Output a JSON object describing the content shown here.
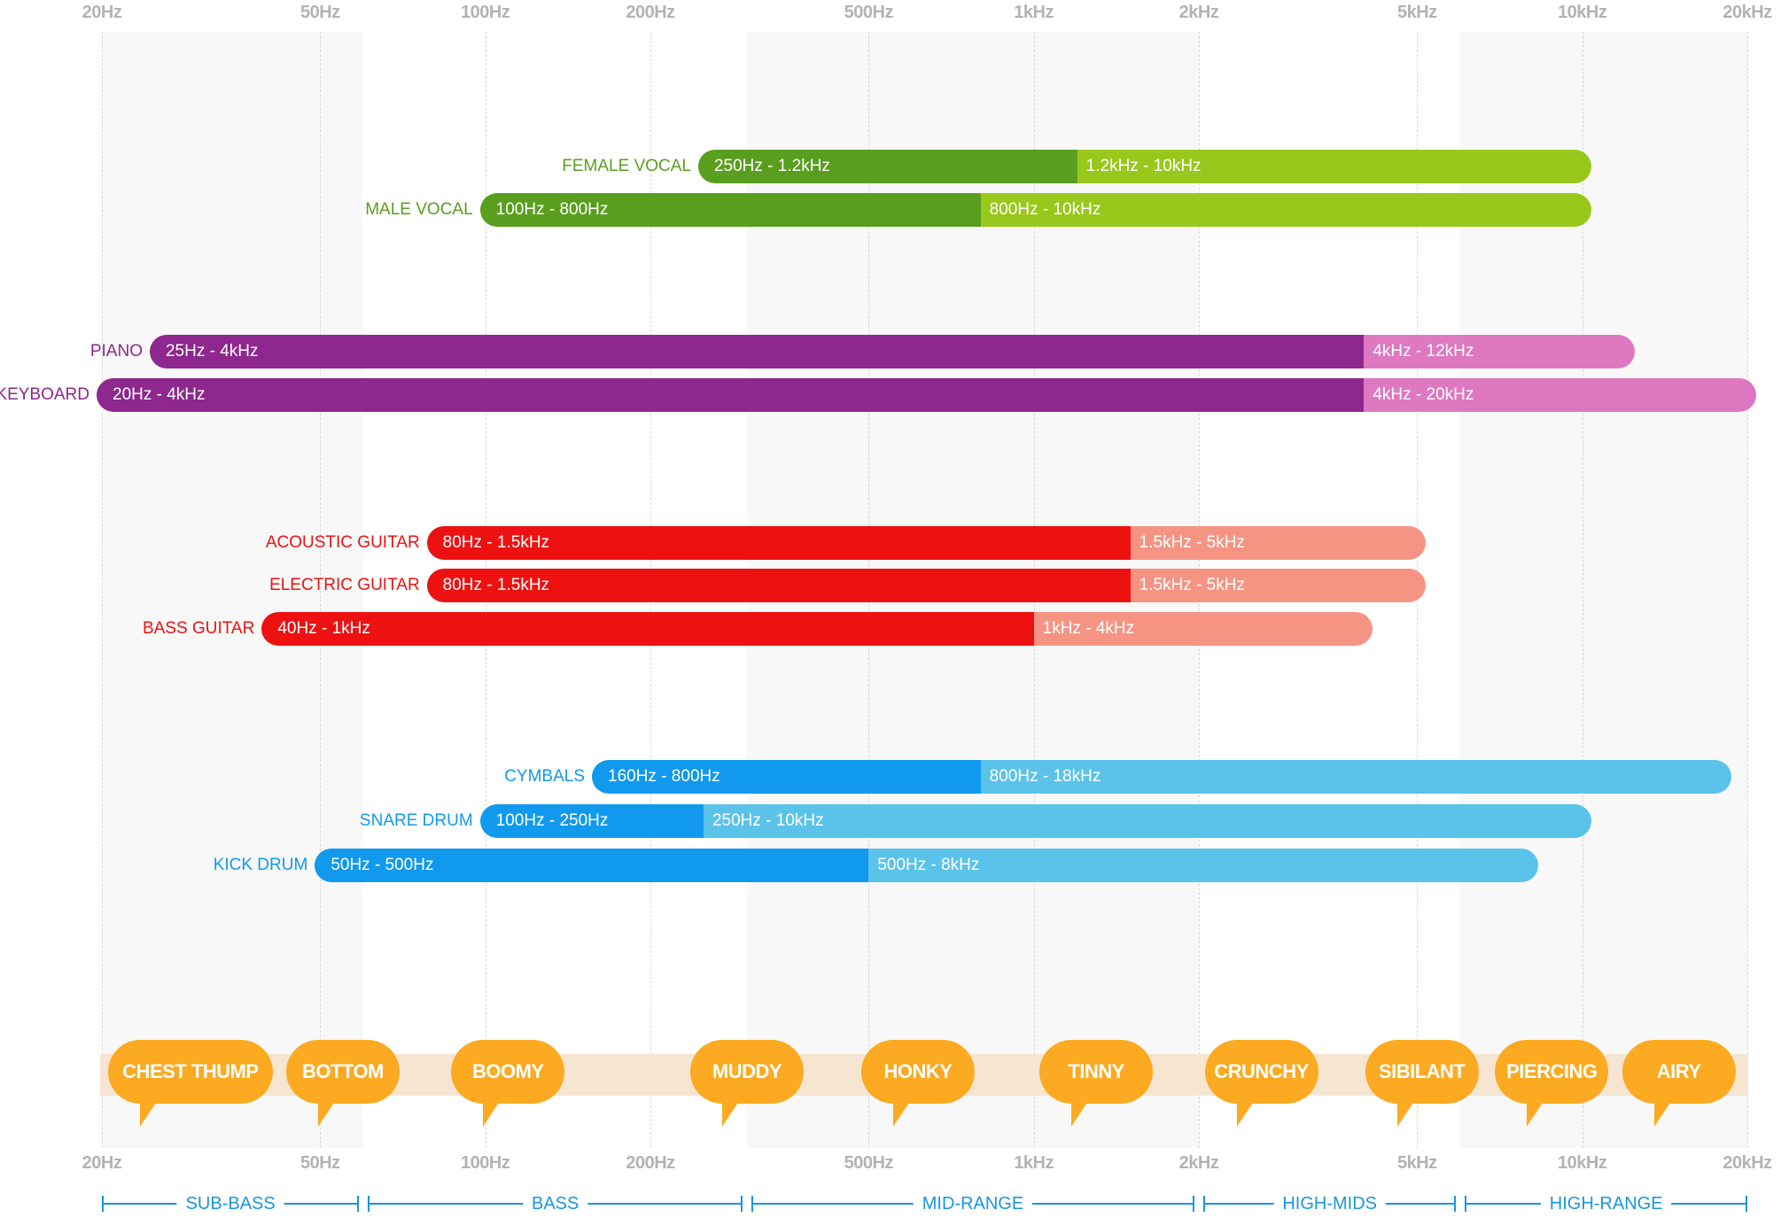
{
  "chart_data": {
    "type": "bar",
    "orientation": "horizontal-range",
    "x_scale": "log",
    "xlim": [
      20,
      20000
    ],
    "grid": true,
    "x_ticks": [
      {
        "label": "20Hz",
        "value": 20
      },
      {
        "label": "50Hz",
        "value": 50
      },
      {
        "label": "100Hz",
        "value": 100
      },
      {
        "label": "200Hz",
        "value": 200
      },
      {
        "label": "500Hz",
        "value": 500
      },
      {
        "label": "1kHz",
        "value": 1000
      },
      {
        "label": "2kHz",
        "value": 2000
      },
      {
        "label": "5kHz",
        "value": 5000
      },
      {
        "label": "10kHz",
        "value": 10000
      },
      {
        "label": "20kHz",
        "value": 20000
      }
    ],
    "colors": {
      "vocal": [
        "#5a9e1f",
        "#99c81c"
      ],
      "keys": [
        "#8e278e",
        "#dd78c1"
      ],
      "guitar": [
        "#ee1111",
        "#f69484"
      ],
      "drums": [
        "#1199ee",
        "#5bc3ea"
      ],
      "tag": "#fbaa22",
      "tag_band": "#f6e5d0",
      "range": "#1a95e0"
    },
    "instruments": [
      {
        "name": "FEMALE VOCAL",
        "group": "vocal",
        "row": 0,
        "segments": [
          {
            "label": "250Hz - 1.2kHz",
            "from": 250,
            "to": 1200
          },
          {
            "label": "1.2kHz - 10kHz",
            "from": 1200,
            "to": 10000
          }
        ]
      },
      {
        "name": "MALE VOCAL",
        "group": "vocal",
        "row": 1,
        "segments": [
          {
            "label": "100Hz - 800Hz",
            "from": 100,
            "to": 800
          },
          {
            "label": "800Hz - 10kHz",
            "from": 800,
            "to": 10000
          }
        ]
      },
      {
        "name": "PIANO",
        "group": "keys",
        "row": 2,
        "segments": [
          {
            "label": "25Hz - 4kHz",
            "from": 25,
            "to": 4000
          },
          {
            "label": "4kHz - 12kHz",
            "from": 4000,
            "to": 12000
          }
        ]
      },
      {
        "name": "KEYBOARD",
        "group": "keys",
        "row": 3,
        "segments": [
          {
            "label": "20Hz - 4kHz",
            "from": 20,
            "to": 4000
          },
          {
            "label": "4kHz - 20kHz",
            "from": 4000,
            "to": 20000
          }
        ]
      },
      {
        "name": "ACOUSTIC GUITAR",
        "group": "guitar",
        "row": 4,
        "segments": [
          {
            "label": "80Hz - 1.5kHz",
            "from": 80,
            "to": 1500
          },
          {
            "label": "1.5kHz - 5kHz",
            "from": 1500,
            "to": 5000
          }
        ]
      },
      {
        "name": "ELECTRIC GUITAR",
        "group": "guitar",
        "row": 5,
        "segments": [
          {
            "label": "80Hz - 1.5kHz",
            "from": 80,
            "to": 1500
          },
          {
            "label": "1.5kHz - 5kHz",
            "from": 1500,
            "to": 5000
          }
        ]
      },
      {
        "name": "BASS GUITAR",
        "group": "guitar",
        "row": 6,
        "segments": [
          {
            "label": "40Hz - 1kHz",
            "from": 40,
            "to": 1000
          },
          {
            "label": "1kHz - 4kHz",
            "from": 1000,
            "to": 4000
          }
        ]
      },
      {
        "name": "CYMBALS",
        "group": "drums",
        "row": 7,
        "segments": [
          {
            "label": "160Hz - 800Hz",
            "from": 160,
            "to": 800
          },
          {
            "label": "800Hz - 18kHz",
            "from": 800,
            "to": 18000
          }
        ]
      },
      {
        "name": "SNARE DRUM",
        "group": "drums",
        "row": 8,
        "segments": [
          {
            "label": "100Hz - 250Hz",
            "from": 100,
            "to": 250
          },
          {
            "label": "250Hz - 10kHz",
            "from": 250,
            "to": 10000
          }
        ]
      },
      {
        "name": "KICK DRUM",
        "group": "drums",
        "row": 9,
        "segments": [
          {
            "label": "50Hz - 500Hz",
            "from": 50,
            "to": 500
          },
          {
            "label": "500Hz - 8kHz",
            "from": 500,
            "to": 8000
          }
        ]
      }
    ],
    "tags": [
      {
        "label": "CHEST THUMP",
        "freq": 29
      },
      {
        "label": "BOTTOM",
        "freq": 55
      },
      {
        "label": "BOOMY",
        "freq": 110
      },
      {
        "label": "MUDDY",
        "freq": 300
      },
      {
        "label": "HONKY",
        "freq": 615
      },
      {
        "label": "TINNY",
        "freq": 1300
      },
      {
        "label": "CRUNCHY",
        "freq": 2600
      },
      {
        "label": "SIBILANT",
        "freq": 5100
      },
      {
        "label": "PIERCING",
        "freq": 8800
      },
      {
        "label": "AIRY",
        "freq": 15000
      }
    ],
    "ranges": [
      {
        "label": "SUB-BASS",
        "from": 20,
        "to": 60
      },
      {
        "label": "BASS",
        "from": 60,
        "to": 300
      },
      {
        "label": "MID-RANGE",
        "from": 300,
        "to": 2000
      },
      {
        "label": "HIGH-MIDS",
        "from": 2000,
        "to": 6000
      },
      {
        "label": "HIGH-RANGE",
        "from": 6000,
        "to": 20000
      }
    ]
  }
}
